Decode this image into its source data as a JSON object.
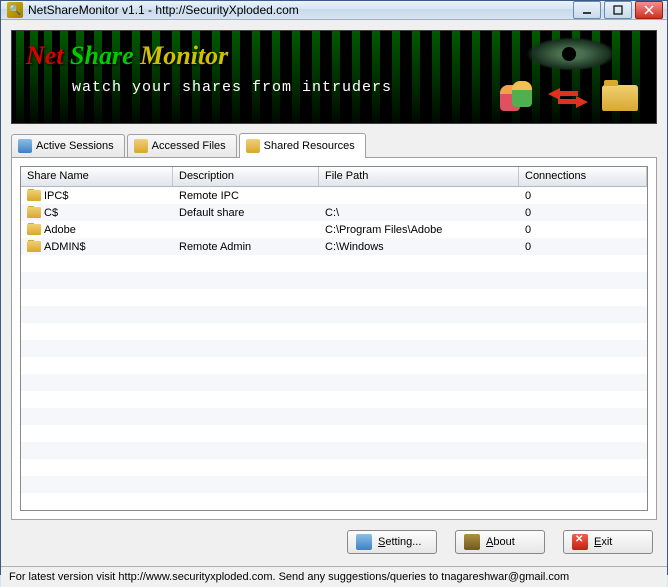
{
  "window": {
    "title": "NetShareMonitor v1.1 - http://SecurityXploded.com"
  },
  "banner": {
    "title_net": "Net",
    "title_share": "Share",
    "title_mon": "Monitor",
    "subtitle": "watch your shares from intruders"
  },
  "tabs": [
    {
      "label": "Active Sessions",
      "icon": "sess"
    },
    {
      "label": "Accessed Files",
      "icon": "file"
    },
    {
      "label": "Shared Resources",
      "icon": "share"
    }
  ],
  "active_tab": 2,
  "columns": [
    "Share Name",
    "Description",
    "File Path",
    "Connections"
  ],
  "rows": [
    {
      "name": "IPC$",
      "desc": "Remote IPC",
      "path": "",
      "conn": "0"
    },
    {
      "name": "C$",
      "desc": "Default share",
      "path": "C:\\",
      "conn": "0"
    },
    {
      "name": "Adobe",
      "desc": "",
      "path": "C:\\Program Files\\Adobe",
      "conn": "0"
    },
    {
      "name": "ADMIN$",
      "desc": "Remote Admin",
      "path": "C:\\Windows",
      "conn": "0"
    }
  ],
  "buttons": {
    "setting": "Setting...",
    "about": "About",
    "exit": "Exit"
  },
  "status": "For latest version visit http://www.securityxploded.com. Send any suggestions/queries to tnagareshwar@gmail.com"
}
